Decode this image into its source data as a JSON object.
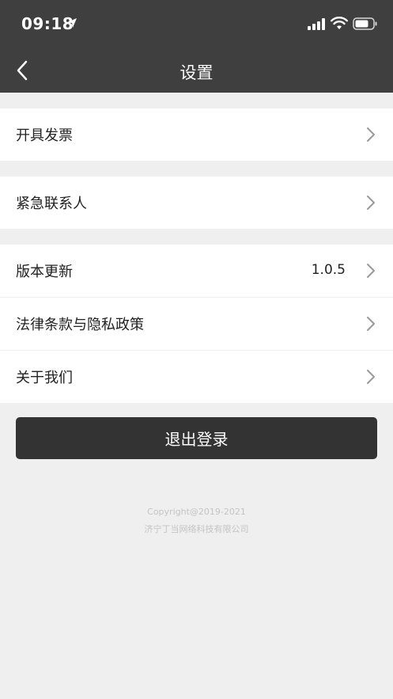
{
  "status_bar": {
    "time": "09:18",
    "icons": [
      "location-arrow-icon",
      "signal-icon",
      "wifi-icon",
      "battery-icon"
    ]
  },
  "nav": {
    "title": "设置",
    "back_icon": "chevron-left-icon"
  },
  "groups": [
    {
      "items": [
        {
          "label": "开具发票",
          "icon": "chevron-right-icon"
        }
      ]
    },
    {
      "items": [
        {
          "label": "紧急联系人",
          "icon": "chevron-right-icon"
        }
      ]
    },
    {
      "items": [
        {
          "label": "版本更新",
          "value": "1.0.5",
          "icon": "chevron-right-icon"
        },
        {
          "label": "法律条款与隐私政策",
          "icon": "chevron-right-icon"
        },
        {
          "label": "关于我们",
          "icon": "chevron-right-icon"
        }
      ]
    }
  ],
  "logout_label": "退出登录",
  "footer": {
    "copyright": "Copyright@2019-2021",
    "company": "济宁丁当网络科技有限公司"
  },
  "colors": {
    "header_bg": "#3f3f3f",
    "page_bg": "#efefef",
    "button_bg": "#333333"
  }
}
